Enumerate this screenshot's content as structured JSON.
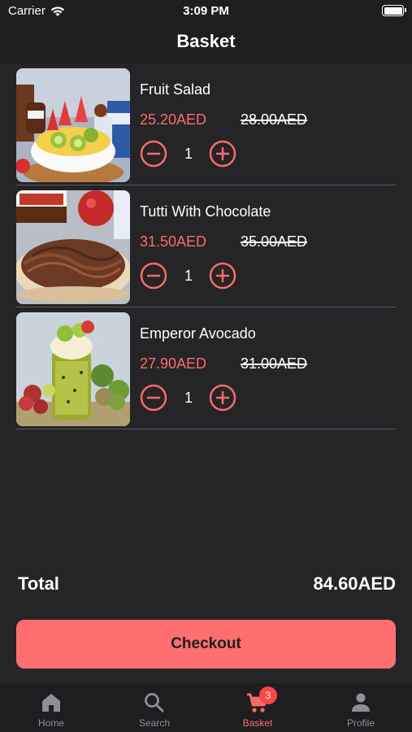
{
  "status_bar": {
    "carrier": "Carrier",
    "time": "3:09 PM"
  },
  "header": {
    "title": "Basket"
  },
  "items": [
    {
      "name": "Fruit Salad",
      "price": "25.20AED",
      "old_price": "28.00AED",
      "quantity": "1"
    },
    {
      "name": "Tutti With Chocolate",
      "price": "31.50AED",
      "old_price": "35.00AED",
      "quantity": "1"
    },
    {
      "name": "Emperor Avocado",
      "price": "27.90AED",
      "old_price": "31.00AED",
      "quantity": "1"
    }
  ],
  "summary": {
    "total_label": "Total",
    "total_value": "84.60AED"
  },
  "checkout": {
    "label": "Checkout"
  },
  "tabbar": {
    "tabs": [
      {
        "label": "Home",
        "icon": "home-icon"
      },
      {
        "label": "Search",
        "icon": "search-icon"
      },
      {
        "label": "Basket",
        "icon": "cart-icon",
        "badge": "3",
        "active": true
      },
      {
        "label": "Profile",
        "icon": "person-icon"
      }
    ]
  },
  "colors": {
    "accent": "#ff6b6b",
    "background": "#252527",
    "bar": "#1e1e20",
    "button": "#ff6f6f"
  }
}
